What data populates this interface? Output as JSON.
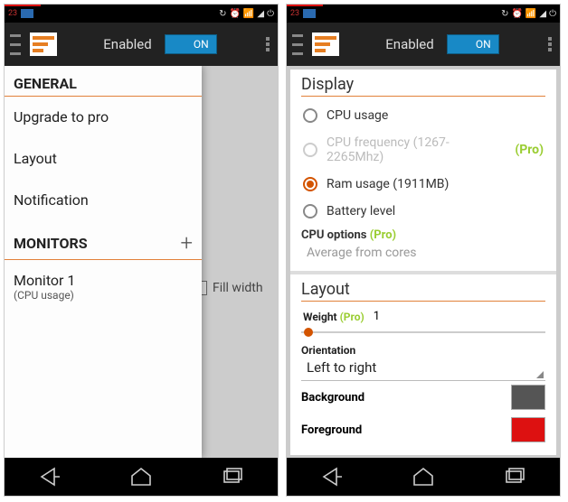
{
  "statusbar": {
    "num": "23"
  },
  "actionbar": {
    "enabled_label": "Enabled",
    "toggle_text": "ON"
  },
  "left": {
    "general_header": "GENERAL",
    "items": {
      "upgrade": "Upgrade to pro",
      "layout": "Layout",
      "notification": "Notification"
    },
    "monitors_header": "MONITORS",
    "monitor1": {
      "label": "Monitor 1",
      "sub": "(CPU usage)"
    },
    "fill_width": "Fill width"
  },
  "right": {
    "display": {
      "header": "Display",
      "cpu_usage": "CPU usage",
      "cpu_freq": "CPU frequency (1267-2265Mhz)",
      "ram": "Ram usage (1911MB)",
      "battery": "Battery level",
      "cpu_options": "CPU options",
      "avg": "Average from cores",
      "pro": "(Pro)"
    },
    "layout": {
      "header": "Layout",
      "weight_label": "Weight",
      "weight_value": "1",
      "orientation_label": "Orientation",
      "orientation_value": "Left to right",
      "background": "Background",
      "foreground": "Foreground",
      "pro": "(Pro)"
    }
  }
}
